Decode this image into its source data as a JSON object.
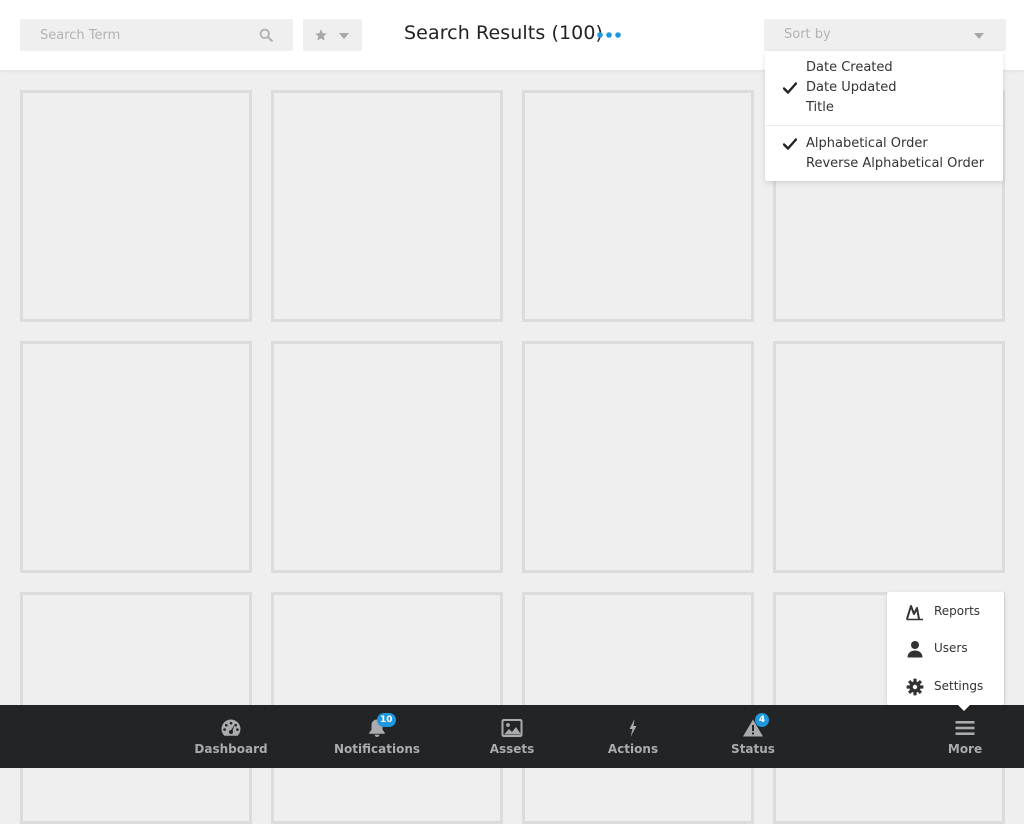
{
  "header": {
    "search": {
      "placeholder": "Search Term"
    },
    "title": "Search Results (100)",
    "sort": {
      "label": "Sort by"
    }
  },
  "sort_menu": {
    "field_options": [
      {
        "label": "Date Created",
        "checked": false
      },
      {
        "label": "Date Updated",
        "checked": true
      },
      {
        "label": "Title",
        "checked": false
      }
    ],
    "order_options": [
      {
        "label": "Alphabetical Order",
        "checked": true
      },
      {
        "label": "Reverse Alphabetical Order",
        "checked": false
      }
    ]
  },
  "more_menu": {
    "items": [
      {
        "label": "Reports",
        "icon": "reports-icon"
      },
      {
        "label": "Users",
        "icon": "user-icon"
      },
      {
        "label": "Settings",
        "icon": "gear-icon"
      }
    ]
  },
  "bottom_nav": {
    "items": [
      {
        "label": "Dashboard",
        "icon": "dashboard-icon"
      },
      {
        "label": "Notifications",
        "icon": "bell-icon",
        "badge": "10"
      },
      {
        "label": "Assets",
        "icon": "image-icon"
      },
      {
        "label": "Actions",
        "icon": "lightning-icon"
      },
      {
        "label": "Status",
        "icon": "warning-icon",
        "badge": "4"
      },
      {
        "label": "More",
        "icon": "hamburger-icon"
      }
    ]
  },
  "colors": {
    "accent": "#1e98de",
    "bottom_bar": "#222426",
    "tile_border": "#dcdcdc",
    "background": "#efefef"
  }
}
